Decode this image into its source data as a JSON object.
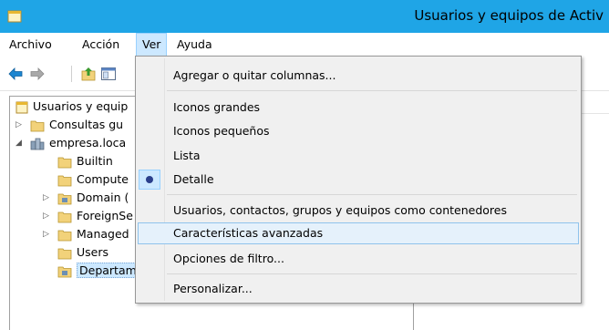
{
  "window": {
    "title": "Usuarios y equipos de Activ"
  },
  "menubar": {
    "items": [
      {
        "label": "Archivo"
      },
      {
        "label": "Acción"
      },
      {
        "label": "Ver"
      },
      {
        "label": "Ayuda"
      }
    ]
  },
  "toolbar": {
    "buttons": [
      "back-arrow-icon",
      "forward-arrow-icon",
      "up-folder-icon",
      "show-hide-console-tree-icon"
    ]
  },
  "tree": {
    "items": [
      {
        "label": "Usuarios y equip"
      },
      {
        "label": "Consultas gu"
      },
      {
        "label": "empresa.loca"
      },
      {
        "label": "Builtin"
      },
      {
        "label": "Compute"
      },
      {
        "label": "Domain ("
      },
      {
        "label": "ForeignSe"
      },
      {
        "label": "Managed"
      },
      {
        "label": "Users"
      },
      {
        "label": "Departam"
      }
    ],
    "expanders": {
      "collapsed": "▷",
      "expanded": "◢"
    }
  },
  "view_menu": {
    "items": [
      {
        "label": "Agregar o quitar columnas..."
      },
      {
        "label": "Iconos grandes"
      },
      {
        "label": "Iconos pequeños"
      },
      {
        "label": "Lista"
      },
      {
        "label": "Detalle",
        "checked": true
      },
      {
        "label": "Usuarios, contactos, grupos y equipos como contenedores"
      },
      {
        "label": "Características avanzadas",
        "highlighted": true
      },
      {
        "label": "Opciones de filtro..."
      },
      {
        "label": "Personalizar..."
      }
    ]
  },
  "colors": {
    "titlebar": "#1fa5e6",
    "menu_active": "#cce8ff",
    "menu_hover": "#e5f1fb",
    "folder": "#f2d27a",
    "check_dot": "#2a3f8c"
  }
}
